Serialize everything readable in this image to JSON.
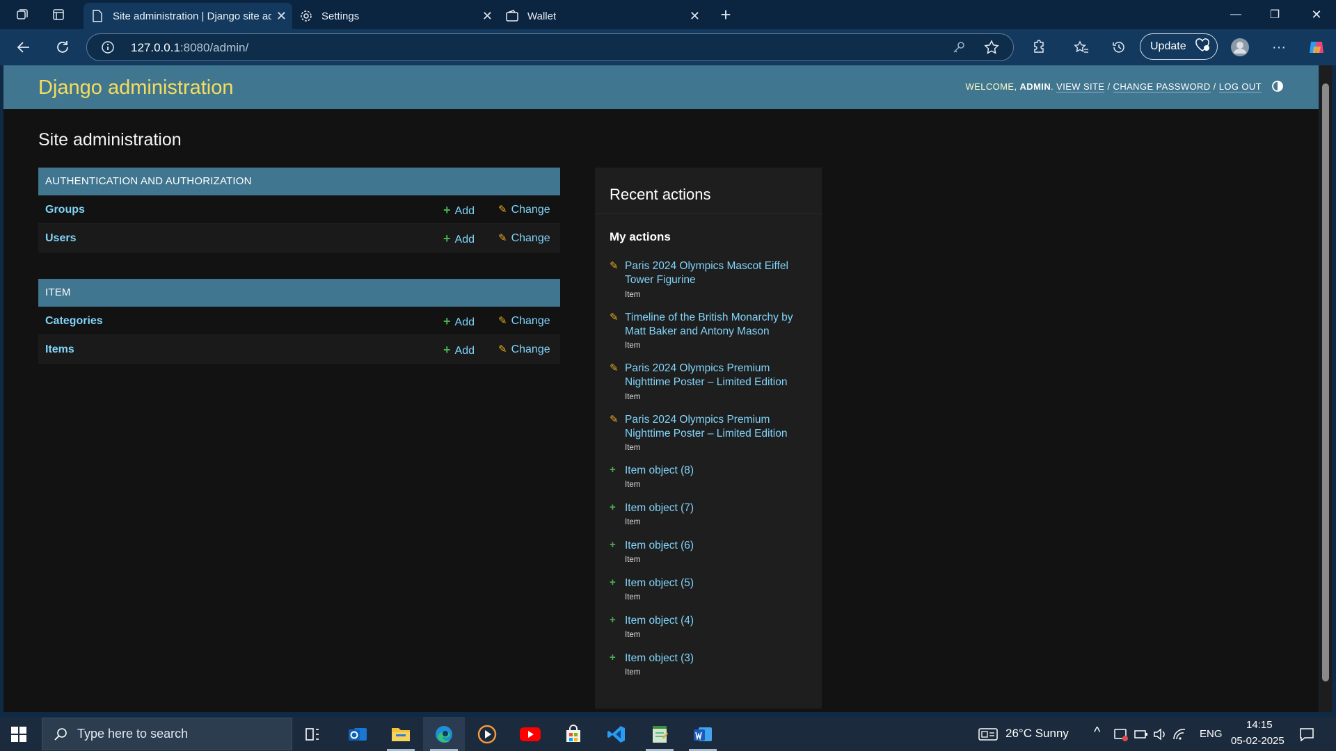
{
  "browser": {
    "tabs": [
      {
        "title": "Site administration | Django site admin",
        "active": true,
        "icon": "page-icon"
      },
      {
        "title": "Settings",
        "active": false,
        "icon": "gear-icon"
      },
      {
        "title": "Wallet",
        "active": false,
        "icon": "wallet-icon"
      }
    ],
    "address": {
      "host": "127.0.0.1",
      "port_path": ":8080/admin/"
    },
    "update_label": "Update"
  },
  "header": {
    "branding": "Django administration",
    "welcome": "WELCOME,",
    "user": "ADMIN",
    "view_site": "VIEW SITE",
    "change_password": "CHANGE PASSWORD",
    "log_out": "LOG OUT",
    "sep": "/"
  },
  "content": {
    "title": "Site administration",
    "modules": [
      {
        "caption": "AUTHENTICATION AND AUTHORIZATION",
        "models": [
          {
            "name": "Groups",
            "add": "Add",
            "change": "Change"
          },
          {
            "name": "Users",
            "add": "Add",
            "change": "Change"
          }
        ]
      },
      {
        "caption": "ITEM",
        "models": [
          {
            "name": "Categories",
            "add": "Add",
            "change": "Change"
          },
          {
            "name": "Items",
            "add": "Add",
            "change": "Change"
          }
        ]
      }
    ]
  },
  "recent": {
    "title": "Recent actions",
    "subtitle": "My actions",
    "actions": [
      {
        "kind": "change",
        "text": "Paris 2024 Olympics Mascot Eiffel Tower Figurine",
        "type": "Item"
      },
      {
        "kind": "change",
        "text": "Timeline of the British Monarchy by Matt Baker and Antony Mason",
        "type": "Item"
      },
      {
        "kind": "change",
        "text": "Paris 2024 Olympics Premium Nighttime Poster – Limited Edition",
        "type": "Item"
      },
      {
        "kind": "change",
        "text": "Paris 2024 Olympics Premium Nighttime Poster – Limited Edition",
        "type": "Item"
      },
      {
        "kind": "add",
        "text": "Item object (8)",
        "type": "Item"
      },
      {
        "kind": "add",
        "text": "Item object (7)",
        "type": "Item"
      },
      {
        "kind": "add",
        "text": "Item object (6)",
        "type": "Item"
      },
      {
        "kind": "add",
        "text": "Item object (5)",
        "type": "Item"
      },
      {
        "kind": "add",
        "text": "Item object (4)",
        "type": "Item"
      },
      {
        "kind": "add",
        "text": "Item object (3)",
        "type": "Item"
      }
    ]
  },
  "taskbar": {
    "search_placeholder": "Type here to search",
    "weather": "26°C  Sunny",
    "language": "ENG",
    "time": "14:15",
    "date": "05-02-2025",
    "apps": [
      "task-view-icon",
      "outlook-icon",
      "file-explorer-icon",
      "edge-icon",
      "media-player-icon",
      "youtube-icon",
      "store-icon",
      "vscode-icon",
      "notepad-icon",
      "word-icon"
    ]
  },
  "colors": {
    "header": "#417690",
    "branding": "#f5dd5d",
    "link": "#81d4fa",
    "add": "#4caf50",
    "change": "#e6a820"
  }
}
